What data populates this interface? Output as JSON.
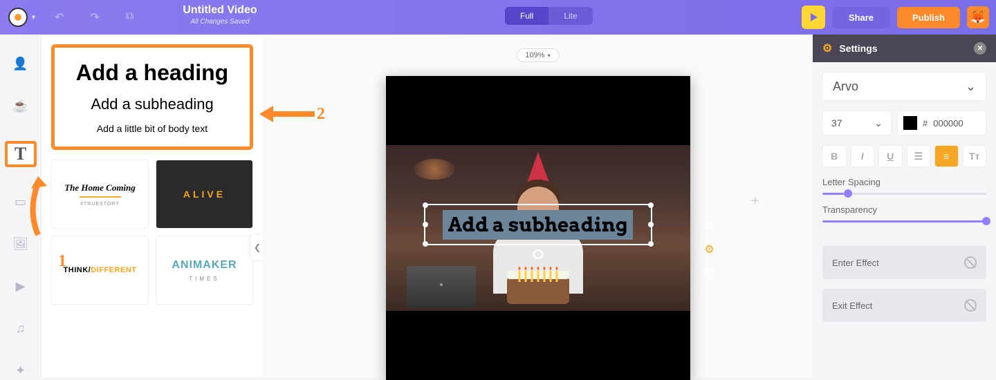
{
  "topbar": {
    "title": "Untitled Video",
    "save_status": "All Changes Saved",
    "mode_full": "Full",
    "mode_lite": "Lite",
    "share": "Share",
    "publish": "Publish"
  },
  "zoom": "109%",
  "text_panel": {
    "heading": "Add a heading",
    "subheading": "Add a subheading",
    "body": "Add a little bit of body text",
    "thumbs": {
      "home_coming": "The Home Coming",
      "home_coming_sub": "#TRUESTORY",
      "alive": "ALIVE",
      "think": "THINK/",
      "different": "DIFFERENT",
      "animaker": "ANIMAKER",
      "times": "TIMES"
    }
  },
  "canvas": {
    "selected_text": "Add a subheading"
  },
  "annotations": {
    "one": "1",
    "two": "2"
  },
  "settings": {
    "title": "Settings",
    "font": "Arvo",
    "size": "37",
    "color_hash": "#",
    "color_hex": "000000",
    "letter_spacing_label": "Letter Spacing",
    "letter_spacing_pct": 13,
    "transparency_label": "Transparency",
    "transparency_pct": 100,
    "enter_effect": "Enter Effect",
    "exit_effect": "Exit Effect",
    "format": {
      "bold": "B",
      "italic": "I",
      "underline": "U",
      "list": "≡",
      "align": "≡",
      "case": "Tᴛ"
    }
  }
}
